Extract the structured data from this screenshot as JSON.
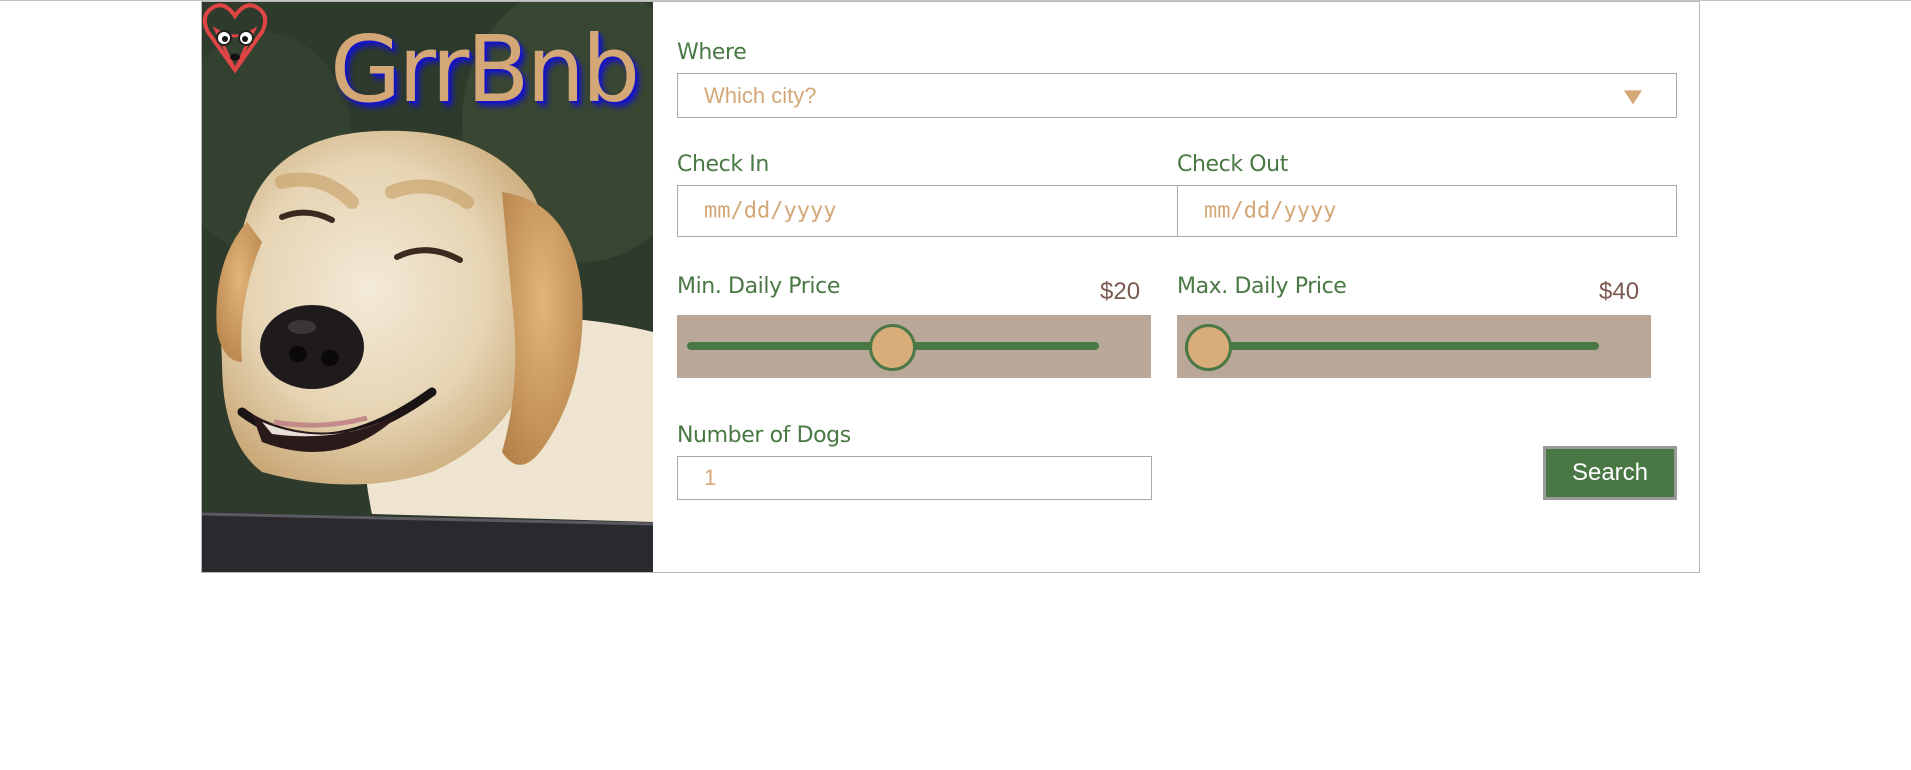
{
  "brand": {
    "name": "GrrBnb"
  },
  "hero": {
    "image": "smiling-labrador-dog-photo"
  },
  "form": {
    "where": {
      "label": "Where",
      "placeholder": "Which city?"
    },
    "check_in": {
      "label": "Check In",
      "placeholder": "mm/dd/yyyy"
    },
    "check_out": {
      "label": "Check Out",
      "placeholder": "mm/dd/yyyy"
    },
    "min_price": {
      "label": "Min. Daily Price",
      "value_text": "$20",
      "slider_fraction": 0.47
    },
    "max_price": {
      "label": "Max. Daily Price",
      "value_text": "$40",
      "slider_fraction": 0.0
    },
    "dogs": {
      "label": "Number of Dogs",
      "placeholder": "1"
    },
    "search_label": "Search"
  },
  "colors": {
    "accent_green": "#4a7844",
    "tan": "#d4a777",
    "slider_bg": "#b9a89a",
    "price_text": "#7a5a50"
  }
}
